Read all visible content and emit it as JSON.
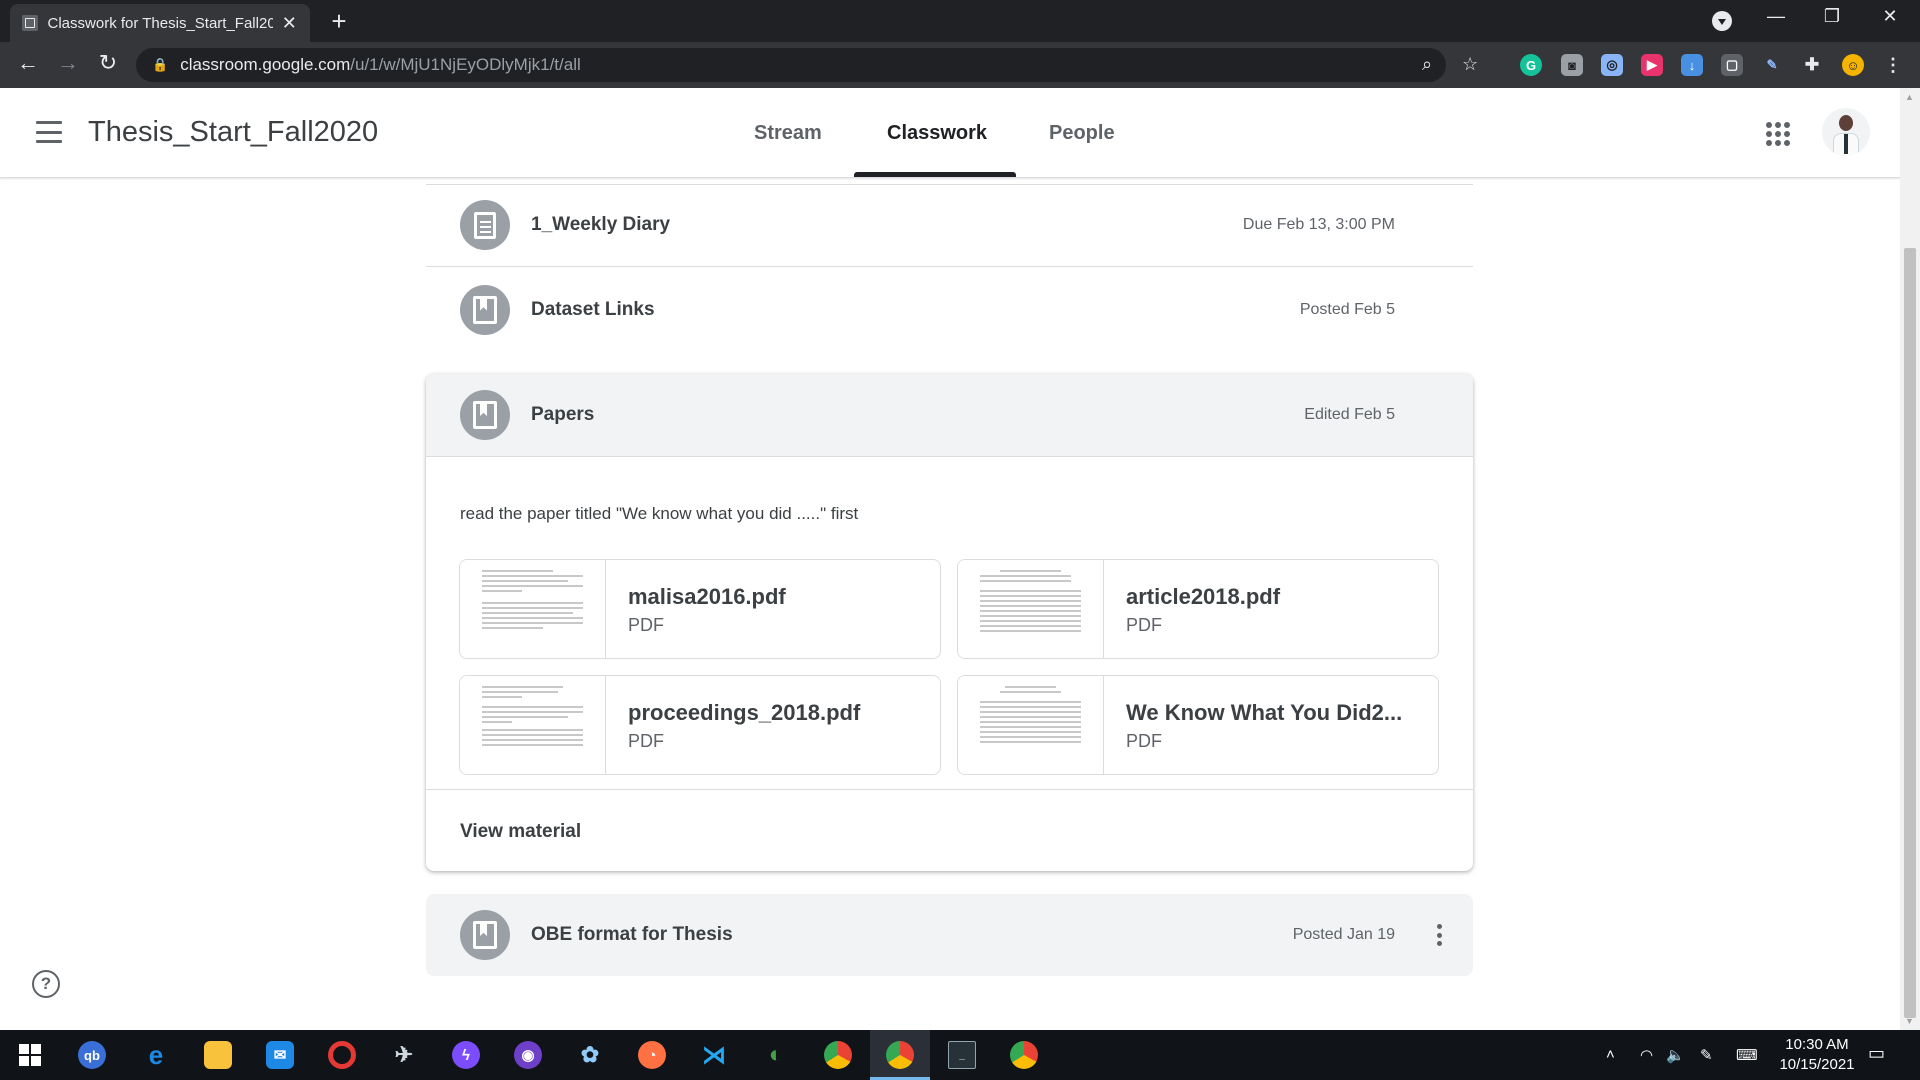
{
  "browser": {
    "tab_title": "Classwork for Thesis_Start_Fall2020",
    "url_host": "classroom.google.com",
    "url_path": "/u/1/w/MjU1NjEyODlyMjk1/t/all"
  },
  "header": {
    "class_title": "Thesis_Start_Fall2020",
    "tabs": [
      {
        "label": "Stream"
      },
      {
        "label": "Classwork"
      },
      {
        "label": "People"
      }
    ],
    "active_tab": "Classwork"
  },
  "items": [
    {
      "title": "1_Weekly Diary",
      "meta": "Due Feb 13, 3:00 PM",
      "icon": "assignment-icon"
    },
    {
      "title": "Dataset Links",
      "meta": "Posted Feb 5",
      "icon": "material-icon"
    }
  ],
  "expanded_card": {
    "title": "Papers",
    "meta": "Edited Feb 5",
    "icon": "material-icon",
    "description": "read the paper titled \"We know what you did .....\" first",
    "attachments": [
      {
        "name": "malisa2016.pdf",
        "type": "PDF"
      },
      {
        "name": "article2018.pdf",
        "type": "PDF"
      },
      {
        "name": "proceedings_2018.pdf",
        "type": "PDF"
      },
      {
        "name": "We Know What You Did2...",
        "type": "PDF"
      }
    ],
    "view_label": "View material"
  },
  "last_item": {
    "title": "OBE format for Thesis",
    "meta": "Posted Jan 19",
    "icon": "material-icon"
  },
  "help": {
    "label": "?"
  },
  "taskbar": {
    "time": "10:30 AM",
    "date": "10/15/2021"
  },
  "colors": {
    "accent_text": "#3c4043",
    "secondary_text": "#5f6368",
    "icon_circle": "#9aa0a6",
    "card_header_bg": "#f1f3f4"
  }
}
